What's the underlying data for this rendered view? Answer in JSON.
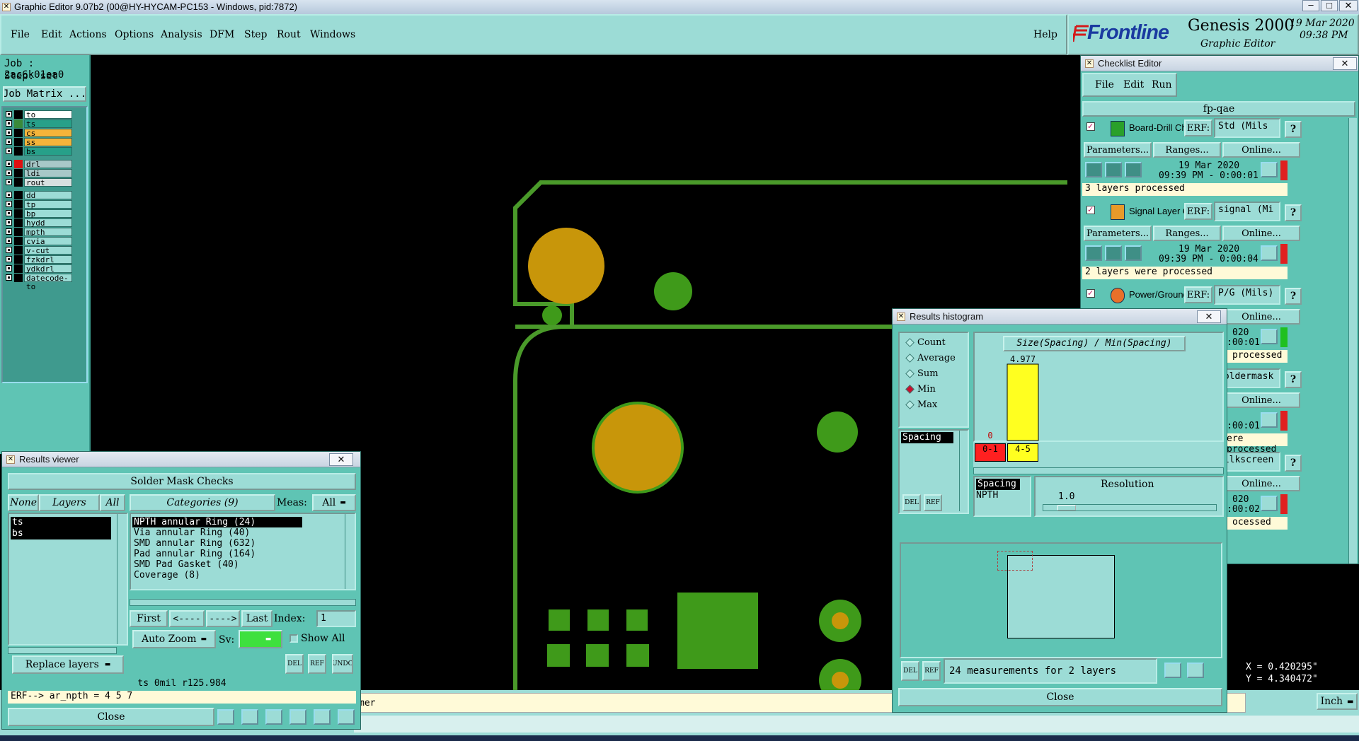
{
  "window": {
    "title": "Graphic Editor 9.07b2 (00@HY-HYCAM-PC153 - Windows, pid:7872)"
  },
  "menu": [
    "File",
    "Edit",
    "Actions",
    "Options",
    "Analysis",
    "DFM",
    "Step",
    "Rout",
    "Windows"
  ],
  "help_label": "Help",
  "brand": {
    "logo": "Frontline",
    "product": "Genesis 2000",
    "subtitle": "Graphic Editor",
    "date": "19 Mar 2020",
    "time": "09:38 PM"
  },
  "job": {
    "job_label": "Job : 2ac6k01ea0",
    "step_label": "Step: set",
    "matrix_button": "Job Matrix ..."
  },
  "layers": [
    {
      "name": "to",
      "sw": "#000",
      "bg": "#ffffff"
    },
    {
      "name": "ts",
      "sw": "#3a8a3a",
      "bg": "#27a089"
    },
    {
      "name": "cs",
      "sw": "#000",
      "bg": "#f4b43a"
    },
    {
      "name": "ss",
      "sw": "#000",
      "bg": "#f4b43a"
    },
    {
      "name": "bs",
      "sw": "#000",
      "bg": "#27a089"
    },
    {
      "name": "drl",
      "sw": "#e01010",
      "bg": "#a8c8c8"
    },
    {
      "name": "ldi",
      "sw": "#000",
      "bg": "#a8c8c8"
    },
    {
      "name": "rout",
      "sw": "#000",
      "bg": "#d8e0e0"
    },
    {
      "name": "dd",
      "sw": "#000",
      "bg": "#9cdcd6"
    },
    {
      "name": "tp",
      "sw": "#000",
      "bg": "#9cdcd6"
    },
    {
      "name": "bp",
      "sw": "#000",
      "bg": "#9cdcd6"
    },
    {
      "name": "hydd",
      "sw": "#000",
      "bg": "#9cdcd6"
    },
    {
      "name": "mpth",
      "sw": "#000",
      "bg": "#9cdcd6"
    },
    {
      "name": "cvia",
      "sw": "#000",
      "bg": "#9cdcd6"
    },
    {
      "name": "v-cut",
      "sw": "#000",
      "bg": "#9cdcd6"
    },
    {
      "name": "fzkdrl",
      "sw": "#000",
      "bg": "#9cdcd6"
    },
    {
      "name": "ydkdrl",
      "sw": "#000",
      "bg": "#9cdcd6"
    },
    {
      "name": "datecode-to",
      "sw": "#000",
      "bg": "#9cdcd6"
    }
  ],
  "checklist": {
    "title": "Checklist Editor",
    "menu": [
      "File",
      "Edit",
      "Run"
    ],
    "name": "fp-qae",
    "erf_label": "ERF:",
    "help_q": "?",
    "params_label": "Parameters...",
    "ranges_label": "Ranges...",
    "online_label": "Online...",
    "items": [
      {
        "name": "Board-Drill Che",
        "erf": "Std (Mils",
        "date": "19 Mar 2020",
        "time": "09:39 PM - 0:00:01",
        "status": "3 layers processed",
        "flag": "#e02020"
      },
      {
        "name": "Signal Layer Ch",
        "erf": "signal (Mi",
        "date": "19 Mar 2020",
        "time": "09:39 PM - 0:00:04",
        "status": "2 layers were processed",
        "flag": "#e02020"
      },
      {
        "name": "Power/Ground C",
        "erf": "P/G (Mils)",
        "time_partial": "020",
        "time2_partial": ":00:01",
        "status_partial": "processed",
        "flag": "#20c020"
      },
      {
        "erf": "Soldermask",
        "time2_partial": ":00:01",
        "status_partial": "ere processed",
        "flag": "#e02020"
      },
      {
        "erf": "Silkscreen",
        "time_partial": "020",
        "time2_partial": ":00:02",
        "status_partial": "ocessed",
        "flag": "#e02020"
      }
    ]
  },
  "histogram": {
    "title": "Results histogram",
    "options": [
      {
        "label": "Count",
        "on": false
      },
      {
        "label": "Average",
        "on": false
      },
      {
        "label": "Sum",
        "on": false
      },
      {
        "label": "Min",
        "on": true
      },
      {
        "label": "Max",
        "on": false
      }
    ],
    "list_selected": "Spacing",
    "header": "Size(Spacing) / Min(Spacing)",
    "bin_list": [
      "Spacing",
      "NPTH"
    ],
    "resolution_label": "Resolution",
    "resolution_value": "1.0",
    "del_label": "DEL",
    "ref_label": "REF",
    "status": "24 measurements for 2 layers",
    "close_label": "Close",
    "chart_data": {
      "type": "bar",
      "categories": [
        "0-1",
        "4-5"
      ],
      "values": [
        0,
        4.977
      ],
      "value_labels": [
        "0",
        "4.977"
      ],
      "colors": [
        "#ff2020",
        "#ffff20"
      ]
    }
  },
  "results": {
    "title": "Results viewer",
    "header": "Solder Mask Checks",
    "none_label": "None",
    "layers_label": "Layers",
    "all_label": "All",
    "categories_label": "Categories (9)",
    "meas_label": "Meas:",
    "meas_value": "All",
    "layers": [
      "ts",
      "bs"
    ],
    "categories": [
      "NPTH annular Ring (24)",
      "Via annular Ring (40)",
      "SMD annular Ring (632)",
      "Pad annular Ring (164)",
      "SMD Pad Gasket (40)",
      "Coverage (8)"
    ],
    "first_label": "First",
    "prev_label": "<----",
    "next_label": "---->",
    "last_label": "Last",
    "index_label": "Index:",
    "index_value": "1",
    "autozoom_label": "Auto Zoom",
    "sv_label": "Sv:",
    "showall_label": "Show All",
    "replace_label": "Replace layers",
    "del_label": "DEL",
    "ref_label": "REF",
    "undo_label": "UNDO",
    "measure_text": "ts 0mil  r125.984",
    "erf_line": "ERF--> ar_npth = 4 5 7",
    "close_label": "Close"
  },
  "status_bar": {
    "partial": "mer",
    "x": "X = 0.420295\"",
    "y": "Y = 4.340472\"",
    "units": "Inch"
  }
}
